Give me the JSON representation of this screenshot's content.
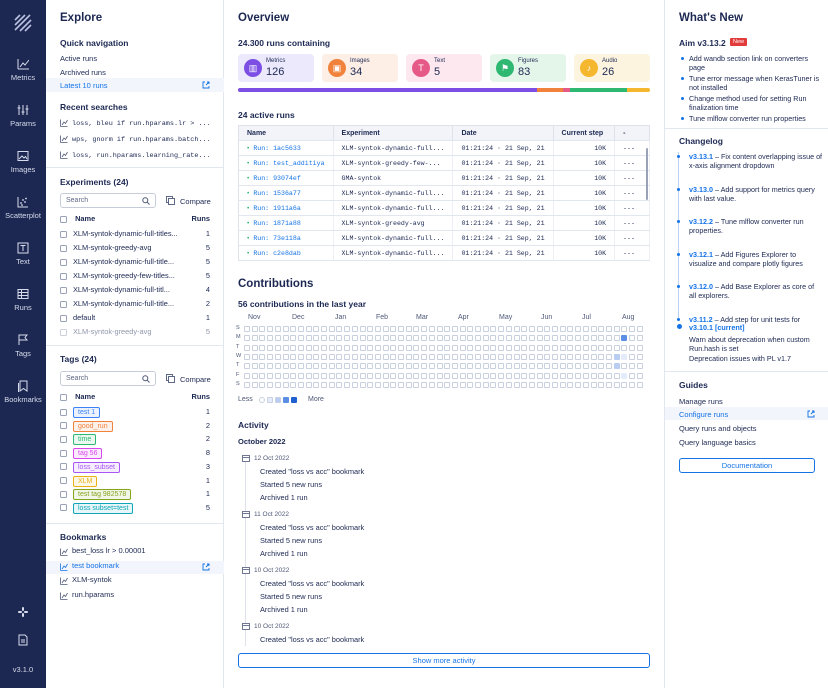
{
  "nav": {
    "items": [
      {
        "label": "Metrics",
        "icon": "metrics-icon"
      },
      {
        "label": "Params",
        "icon": "params-icon"
      },
      {
        "label": "Images",
        "icon": "images-icon"
      },
      {
        "label": "Scatterplot",
        "icon": "scatterplot-icon"
      },
      {
        "label": "Text",
        "icon": "text-icon"
      },
      {
        "label": "Runs",
        "icon": "runs-icon"
      },
      {
        "label": "Tags",
        "icon": "tags-icon"
      },
      {
        "label": "Bookmarks",
        "icon": "bookmarks-icon"
      }
    ],
    "version": "v3.1.0"
  },
  "explore": {
    "title": "Explore",
    "quick_nav_title": "Quick navigation",
    "quick_nav": [
      "Active runs",
      "Archived runs",
      "Latest 10 runs"
    ],
    "recent_title": "Recent searches",
    "recent": [
      "loss, bleu if run.hparams.lr > ...",
      "wps, gnorm if run.hparams.batch...",
      "loss, run.hparams.learning_rate..."
    ],
    "experiments_title": "Experiments (24)",
    "search_placeholder": "Search",
    "compare_label": "Compare",
    "col_name": "Name",
    "col_runs": "Runs",
    "experiments": [
      {
        "name": "XLM-syntok-dynamic-full-titles...",
        "runs": "1"
      },
      {
        "name": "XLM-syntok-greedy-avg",
        "runs": "5"
      },
      {
        "name": "XLM-syntok-dynamic-full-title...",
        "runs": "5"
      },
      {
        "name": "XLM-syntok-greedy-few-titles...",
        "runs": "5"
      },
      {
        "name": "XLM-syntok-dynamic-full-titl...",
        "runs": "4"
      },
      {
        "name": "XLM-syntok-dynamic-full-title...",
        "runs": "2"
      },
      {
        "name": "default",
        "runs": "1"
      },
      {
        "name": "XLM-syntok-greedy-avg",
        "runs": "5"
      }
    ],
    "tags_title": "Tags (24)",
    "tags": [
      {
        "name": "test 1",
        "runs": "1",
        "color": "#3b82f6"
      },
      {
        "name": "good_run",
        "runs": "2",
        "color": "#f0823c"
      },
      {
        "name": "time",
        "runs": "2",
        "color": "#2eb872"
      },
      {
        "name": "tag 56",
        "runs": "8",
        "color": "#d946ef"
      },
      {
        "name": "loss_subset",
        "runs": "3",
        "color": "#a855f7"
      },
      {
        "name": "XLM",
        "runs": "1",
        "color": "#e9b116"
      },
      {
        "name": "test tag 982578",
        "runs": "1",
        "color": "#84a51e"
      },
      {
        "name": "loss subset=test",
        "runs": "5",
        "color": "#10a6b8"
      }
    ],
    "bookmarks_title": "Bookmarks",
    "bookmarks": [
      "best_loss lr > 0.00001",
      "test bookmark",
      "XLM-syntok",
      "run.hparams"
    ]
  },
  "overview": {
    "title": "Overview",
    "runs_heading": "24.300 runs containing",
    "cards": [
      {
        "label": "Metrics",
        "value": "126",
        "bg": "#ece9fc",
        "icon_bg": "#7c4ee4"
      },
      {
        "label": "Images",
        "value": "34",
        "bg": "#fdeee6",
        "icon_bg": "#f0823c"
      },
      {
        "label": "Text",
        "value": "5",
        "bg": "#fde8ef",
        "icon_bg": "#e65a87"
      },
      {
        "label": "Figures",
        "value": "83",
        "bg": "#e4f6ea",
        "icon_bg": "#2eb872"
      },
      {
        "label": "Audio",
        "value": "26",
        "bg": "#fdf4e0",
        "icon_bg": "#f5b72e"
      }
    ],
    "active_title": "24 active runs",
    "table_headers": [
      "Name",
      "Experiment",
      "Date",
      "Current step",
      "-"
    ],
    "table_rows": [
      {
        "name": "Run: 1ac5633",
        "experiment": "XLM-syntok-dynamic-full...",
        "date": "01:21:24 · 21 Sep, 21",
        "step": "10K",
        "extra": "---"
      },
      {
        "name": "Run: test_additiya",
        "experiment": "XLM-syntok-greedy-few-...",
        "date": "01:21:24 · 21 Sep, 21",
        "step": "10K",
        "extra": "---"
      },
      {
        "name": "Run: 93074ef",
        "experiment": "GMA-syntok",
        "date": "01:21:24 · 21 Sep, 21",
        "step": "10K",
        "extra": "---"
      },
      {
        "name": "Run: 1536a77",
        "experiment": "XLM-syntok-dynamic-full...",
        "date": "01:21:24 · 21 Sep, 21",
        "step": "10K",
        "extra": "---"
      },
      {
        "name": "Run: 1911a6a",
        "experiment": "XLM-syntok-dynamic-full...",
        "date": "01:21:24 · 21 Sep, 21",
        "step": "10K",
        "extra": "---"
      },
      {
        "name": "Run: 1871a88",
        "experiment": "XLM-syntok-greedy-avg",
        "date": "01:21:24 · 21 Sep, 21",
        "step": "10K",
        "extra": "---"
      },
      {
        "name": "Run: 73e118a",
        "experiment": "XLM-syntok-dynamic-full...",
        "date": "01:21:24 · 21 Sep, 21",
        "step": "10K",
        "extra": "---"
      },
      {
        "name": "Run: c2e8dab",
        "experiment": "XLM-syntok-dynamic-full...",
        "date": "01:21:24 · 21 Sep, 21",
        "step": "10K",
        "extra": "---"
      }
    ],
    "contrib_title": "Contributions",
    "contrib_subtitle": "56 contributions in the last year",
    "months": [
      "Nov",
      "Dec",
      "Jan",
      "Feb",
      "Mar",
      "Apr",
      "May",
      "Jun",
      "Jul",
      "Aug"
    ],
    "days": [
      "S",
      "M",
      "T",
      "W",
      "T",
      "F",
      "S"
    ],
    "less_label": "Less",
    "more_label": "More",
    "activity_title": "Activity",
    "activity_month": "October 2022",
    "activity": [
      {
        "date": "12 Oct 2022",
        "lines": [
          "Created \"loss vs acc\" bookmark",
          "Started 5 new runs",
          "Archived 1 run"
        ]
      },
      {
        "date": "11 Oct 2022",
        "lines": [
          "Created \"loss vs acc\" bookmark",
          "Started 5 new runs",
          "Archived 1 run"
        ]
      },
      {
        "date": "10 Oct 2022",
        "lines": [
          "Created \"loss vs acc\" bookmark",
          "Started 5 new runs",
          "Archived 1 run"
        ]
      },
      {
        "date": "10 Oct 2022",
        "lines": [
          "Created \"loss vs acc\" bookmark"
        ]
      }
    ],
    "show_more": "Show more activity"
  },
  "whatsnew": {
    "title": "What's New",
    "release": "Aim v3.13.2",
    "new_badge": "New",
    "bullets": [
      "Add wandb section link on converters page",
      "Tune error message when KerasTuner is not installed",
      "Change method used for setting Run finalization time",
      "Tune mlflow converter run properties"
    ],
    "changelog_title": "Changelog",
    "changelog": [
      {
        "version": "v3.13.1",
        "text": " – Fix content overlapping issue of x-axis alignment dropdown"
      },
      {
        "version": "v3.13.0",
        "text": " – Add support for metrics query with last value."
      },
      {
        "version": "v3.12.2",
        "text": " – Tune mlflow converter run properties."
      },
      {
        "version": "v3.12.1",
        "text": " – Add Figures Explorer to visualize and compare plotly figures"
      },
      {
        "version": "v3.12.0",
        "text": " – Add Base Explorer as core of all explorers."
      },
      {
        "version": "v3.11.2",
        "text": " – Add step for unit tests for"
      }
    ],
    "current_version": "v3.10.1 [current]",
    "current_lines": [
      "Warn about deprecation when custom Run.hash is set",
      "Deprecation issues with PL v1.7"
    ],
    "guides_title": "Guides",
    "guides": [
      "Manage runs",
      "Configure runs",
      "Query runs and objects",
      "Query language basics"
    ],
    "doc_button": "Documentation"
  }
}
